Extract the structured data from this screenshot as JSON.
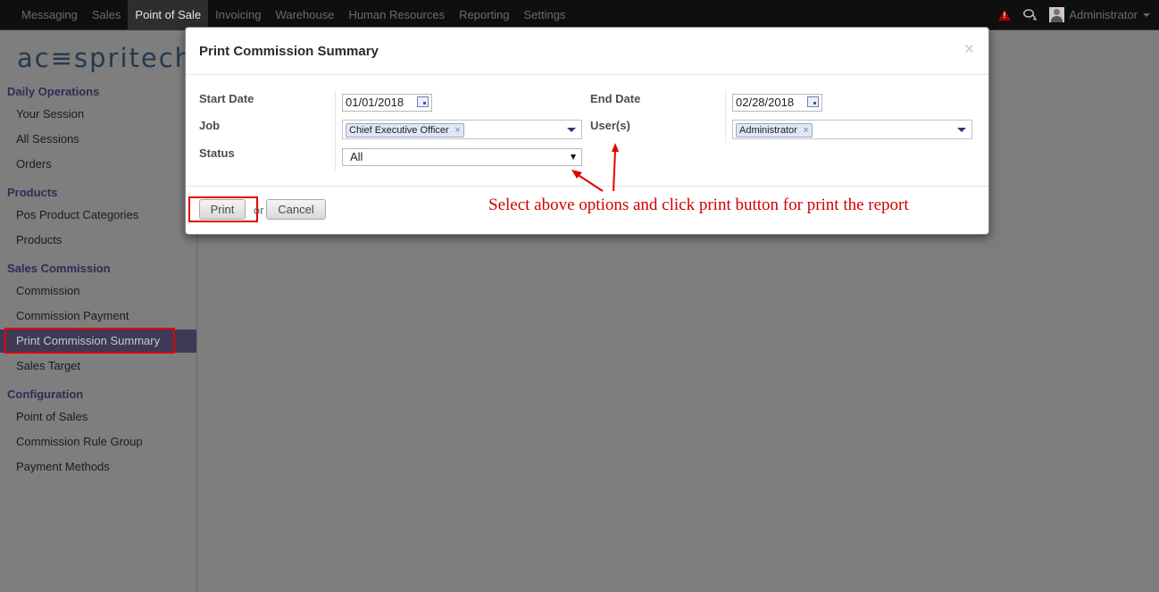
{
  "topbar": {
    "menu": [
      "Messaging",
      "Sales",
      "Point of Sale",
      "Invoicing",
      "Warehouse",
      "Human Resources",
      "Reporting",
      "Settings"
    ],
    "active_menu": "Point of Sale",
    "user": "Administrator"
  },
  "sidebar": {
    "logo": "ac≡spritech",
    "sections": [
      {
        "title": "Daily Operations",
        "items": [
          "Your Session",
          "All Sessions",
          "Orders"
        ]
      },
      {
        "title": "Products",
        "items": [
          "Pos Product Categories",
          "Products"
        ]
      },
      {
        "title": "Sales Commission",
        "items": [
          "Commission",
          "Commission Payment",
          "Print Commission Summary",
          "Sales Target"
        ]
      },
      {
        "title": "Configuration",
        "items": [
          "Point of Sales",
          "Commission Rule Group",
          "Payment Methods"
        ]
      }
    ],
    "selected_item": "Print Commission Summary"
  },
  "dialog": {
    "title": "Print Commission Summary",
    "close_symbol": "×",
    "start_date_label": "Start Date",
    "start_date": "01/01/2018",
    "end_date_label": "End Date",
    "end_date": "02/28/2018",
    "job_label": "Job",
    "job_tag": "Chief Executive Officer",
    "users_label": "User(s)",
    "user_tag": "Administrator",
    "status_label": "Status",
    "status_value": "All",
    "print_label": "Print",
    "or_label": "or",
    "cancel_label": "Cancel",
    "tag_remove_symbol": "×"
  },
  "annotation": "Select above options and click print button for print the report",
  "colors": {
    "annotation": "#e00000",
    "selected_nav": "#3e3a55",
    "section_heading": "#2d2d55"
  }
}
